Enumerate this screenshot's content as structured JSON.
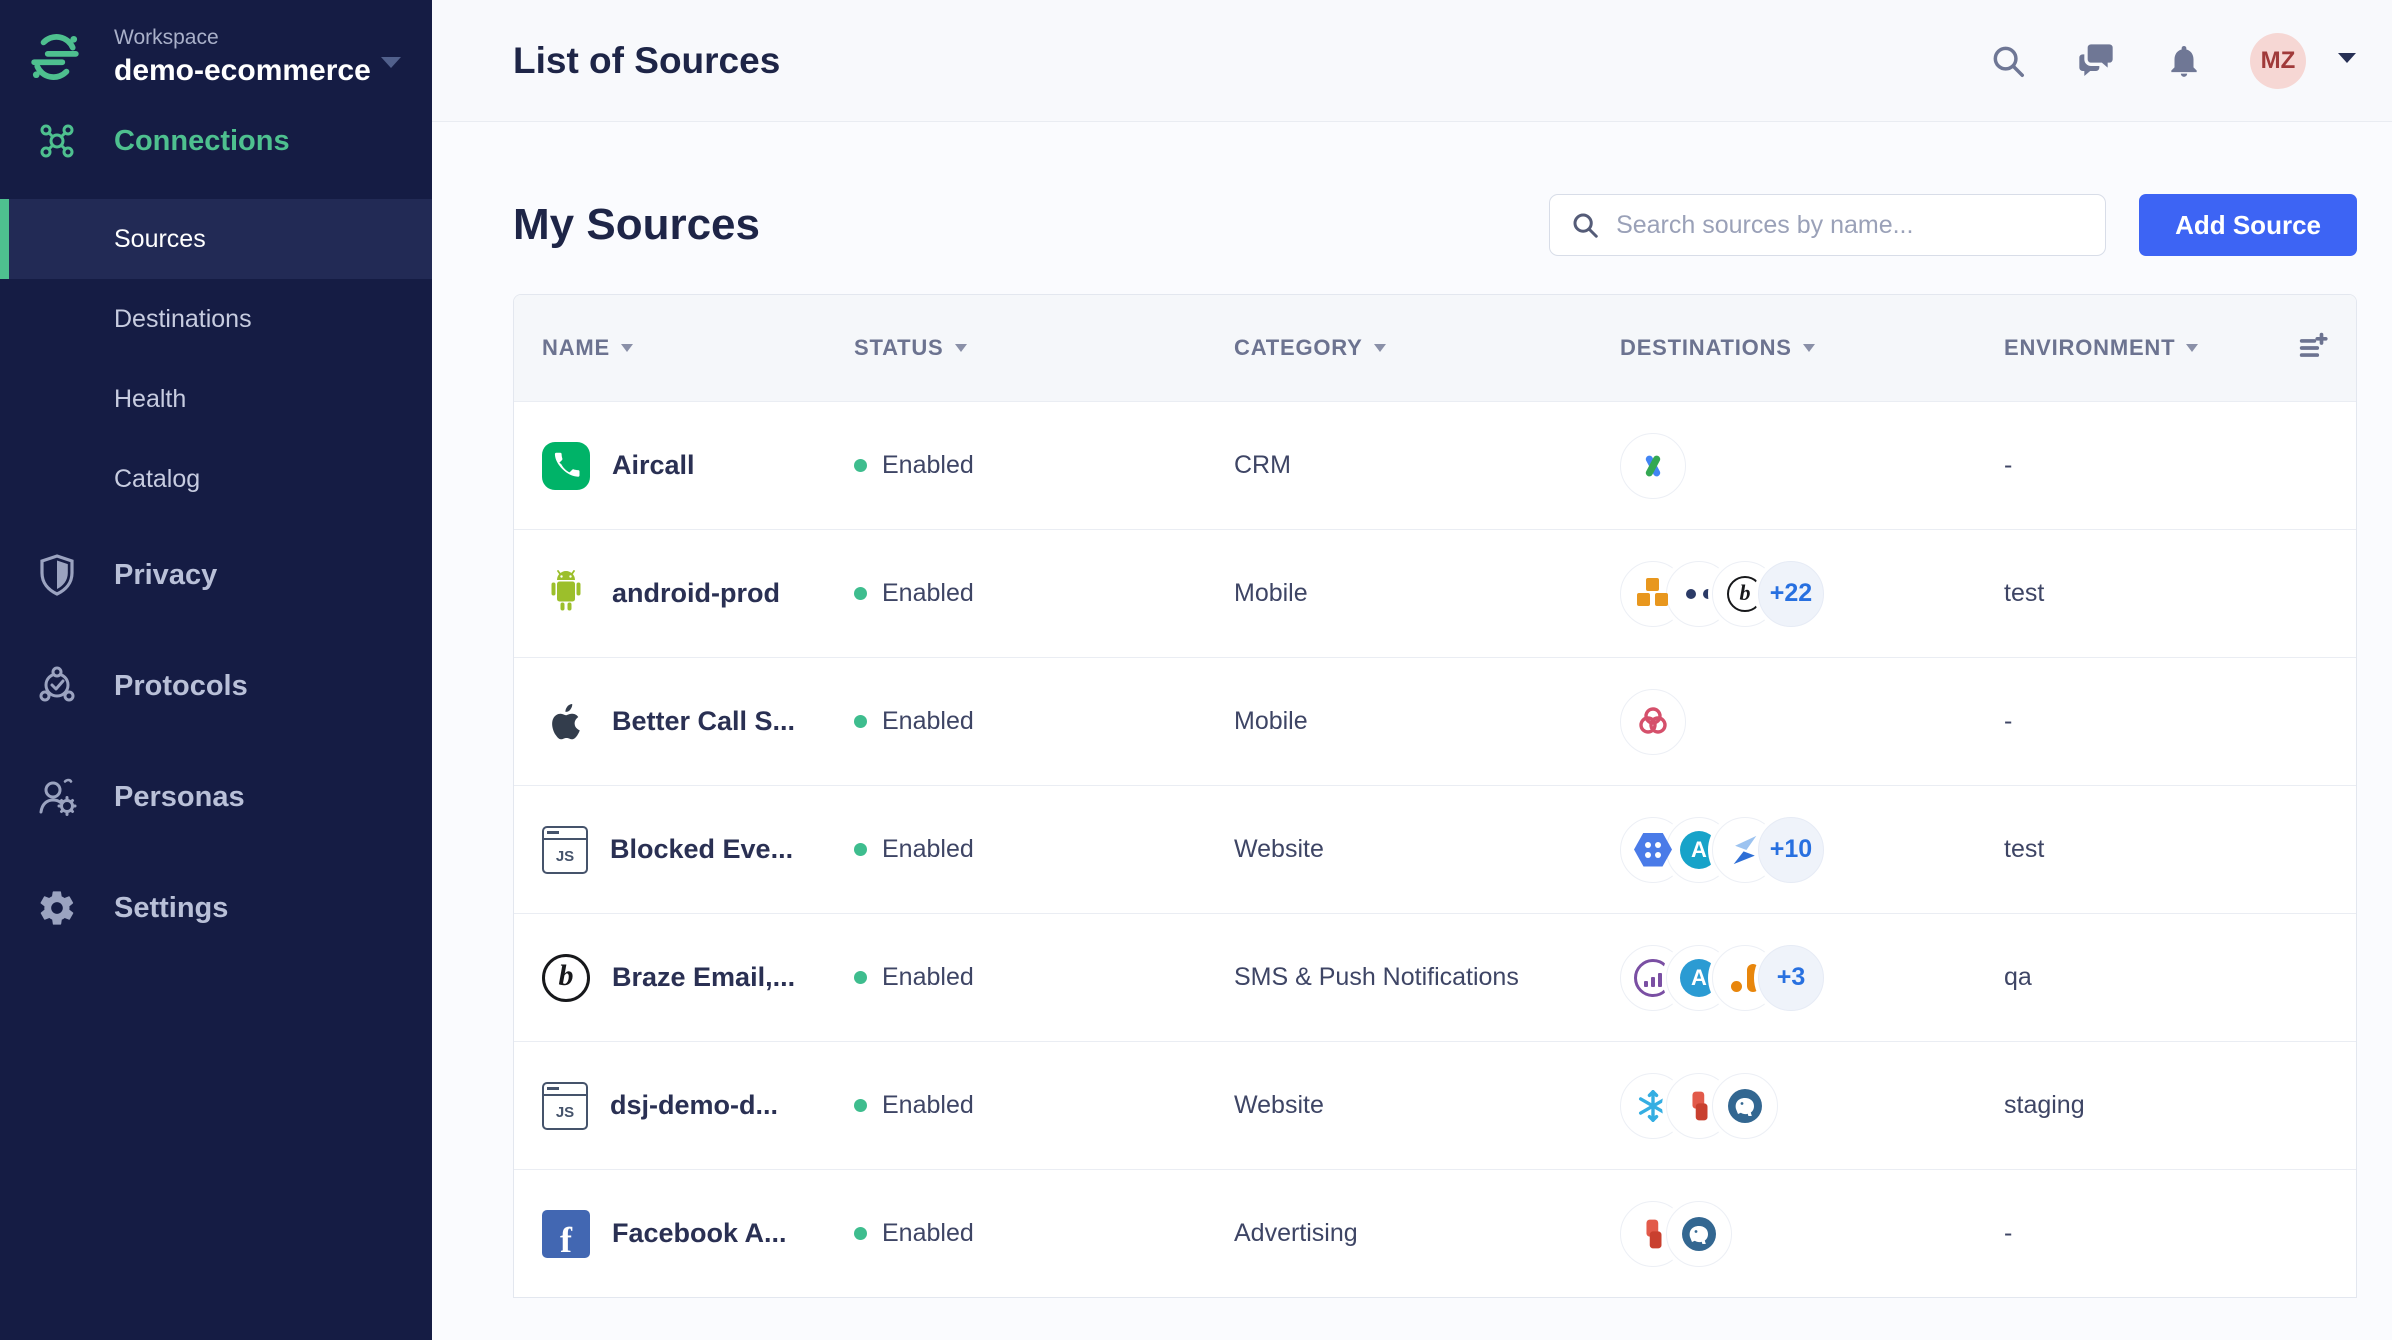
{
  "workspace": {
    "label": "Workspace",
    "name": "demo-ecommerce"
  },
  "sidebar": {
    "connections_label": "Connections",
    "connection_items": [
      {
        "label": "Sources",
        "active": true
      },
      {
        "label": "Destinations",
        "active": false
      },
      {
        "label": "Health",
        "active": false
      },
      {
        "label": "Catalog",
        "active": false
      }
    ],
    "sections": [
      {
        "label": "Privacy"
      },
      {
        "label": "Protocols"
      },
      {
        "label": "Personas"
      },
      {
        "label": "Settings"
      }
    ]
  },
  "header": {
    "title": "List of Sources",
    "avatar_initials": "MZ"
  },
  "main": {
    "title": "My Sources",
    "search_placeholder": "Search sources by name...",
    "add_button_label": "Add Source"
  },
  "table": {
    "columns": {
      "name": "NAME",
      "status": "STATUS",
      "category": "CATEGORY",
      "destinations": "DESTINATIONS",
      "environment": "ENVIRONMENT"
    },
    "rows": [
      {
        "name": "Aircall",
        "status": "Enabled",
        "category": "CRM",
        "environment": "-",
        "source_icon": "aircall-icon",
        "destination_icons": [
          "google-ads-icon"
        ],
        "overflow": ""
      },
      {
        "name": "android-prod",
        "status": "Enabled",
        "category": "Mobile",
        "environment": "test",
        "source_icon": "android-icon",
        "destination_icons": [
          "aws-icon",
          "navy-dots-icon",
          "braze-icon"
        ],
        "overflow": "+22"
      },
      {
        "name": "Better Call S...",
        "status": "Enabled",
        "category": "Mobile",
        "environment": "-",
        "source_icon": "apple-icon",
        "destination_icons": [
          "red-knot-icon"
        ],
        "overflow": ""
      },
      {
        "name": "Blocked Eve...",
        "status": "Enabled",
        "category": "Website",
        "environment": "test",
        "source_icon": "javascript-icon",
        "destination_icons": [
          "blue-hexagon-icon",
          "teal-a-icon",
          "blue-ribbon-icon"
        ],
        "overflow": "+10"
      },
      {
        "name": "Braze Email,...",
        "status": "Enabled",
        "category": "SMS & Push Notifications",
        "environment": "qa",
        "source_icon": "braze-icon",
        "destination_icons": [
          "purple-chart-icon",
          "blue-a-icon",
          "orange-analytics-icon"
        ],
        "overflow": "+3"
      },
      {
        "name": "dsj-demo-d...",
        "status": "Enabled",
        "category": "Website",
        "environment": "staging",
        "source_icon": "javascript-icon",
        "destination_icons": [
          "snowflake-icon",
          "redshift-icon",
          "postgres-icon"
        ],
        "overflow": ""
      },
      {
        "name": "Facebook A...",
        "status": "Enabled",
        "category": "Advertising",
        "environment": "-",
        "source_icon": "facebook-icon",
        "destination_icons": [
          "redshift-icon",
          "postgres-icon"
        ],
        "overflow": ""
      }
    ]
  },
  "icons": {
    "segment-logo-icon": "green segment mark",
    "search-icon": "magnifier",
    "chat-icon": "speech bubbles",
    "bell-icon": "notification bell",
    "chevron-down-icon": "filled caret",
    "add-column-icon": "list with plus",
    "status-dot": "green circle"
  },
  "colors": {
    "sidebar_bg": "#151C44",
    "sidebar_active_bg": "#222A55",
    "accent_green": "#4EC08F",
    "primary_blue": "#3D64F4",
    "status_green": "#3EBD8E",
    "overflow_blue": "#2870E0",
    "avatar_bg": "#F6D7D4",
    "avatar_text": "#A03A3A"
  },
  "js_badge": "JS",
  "braze_glyph": "b",
  "facebook_glyph": "f"
}
